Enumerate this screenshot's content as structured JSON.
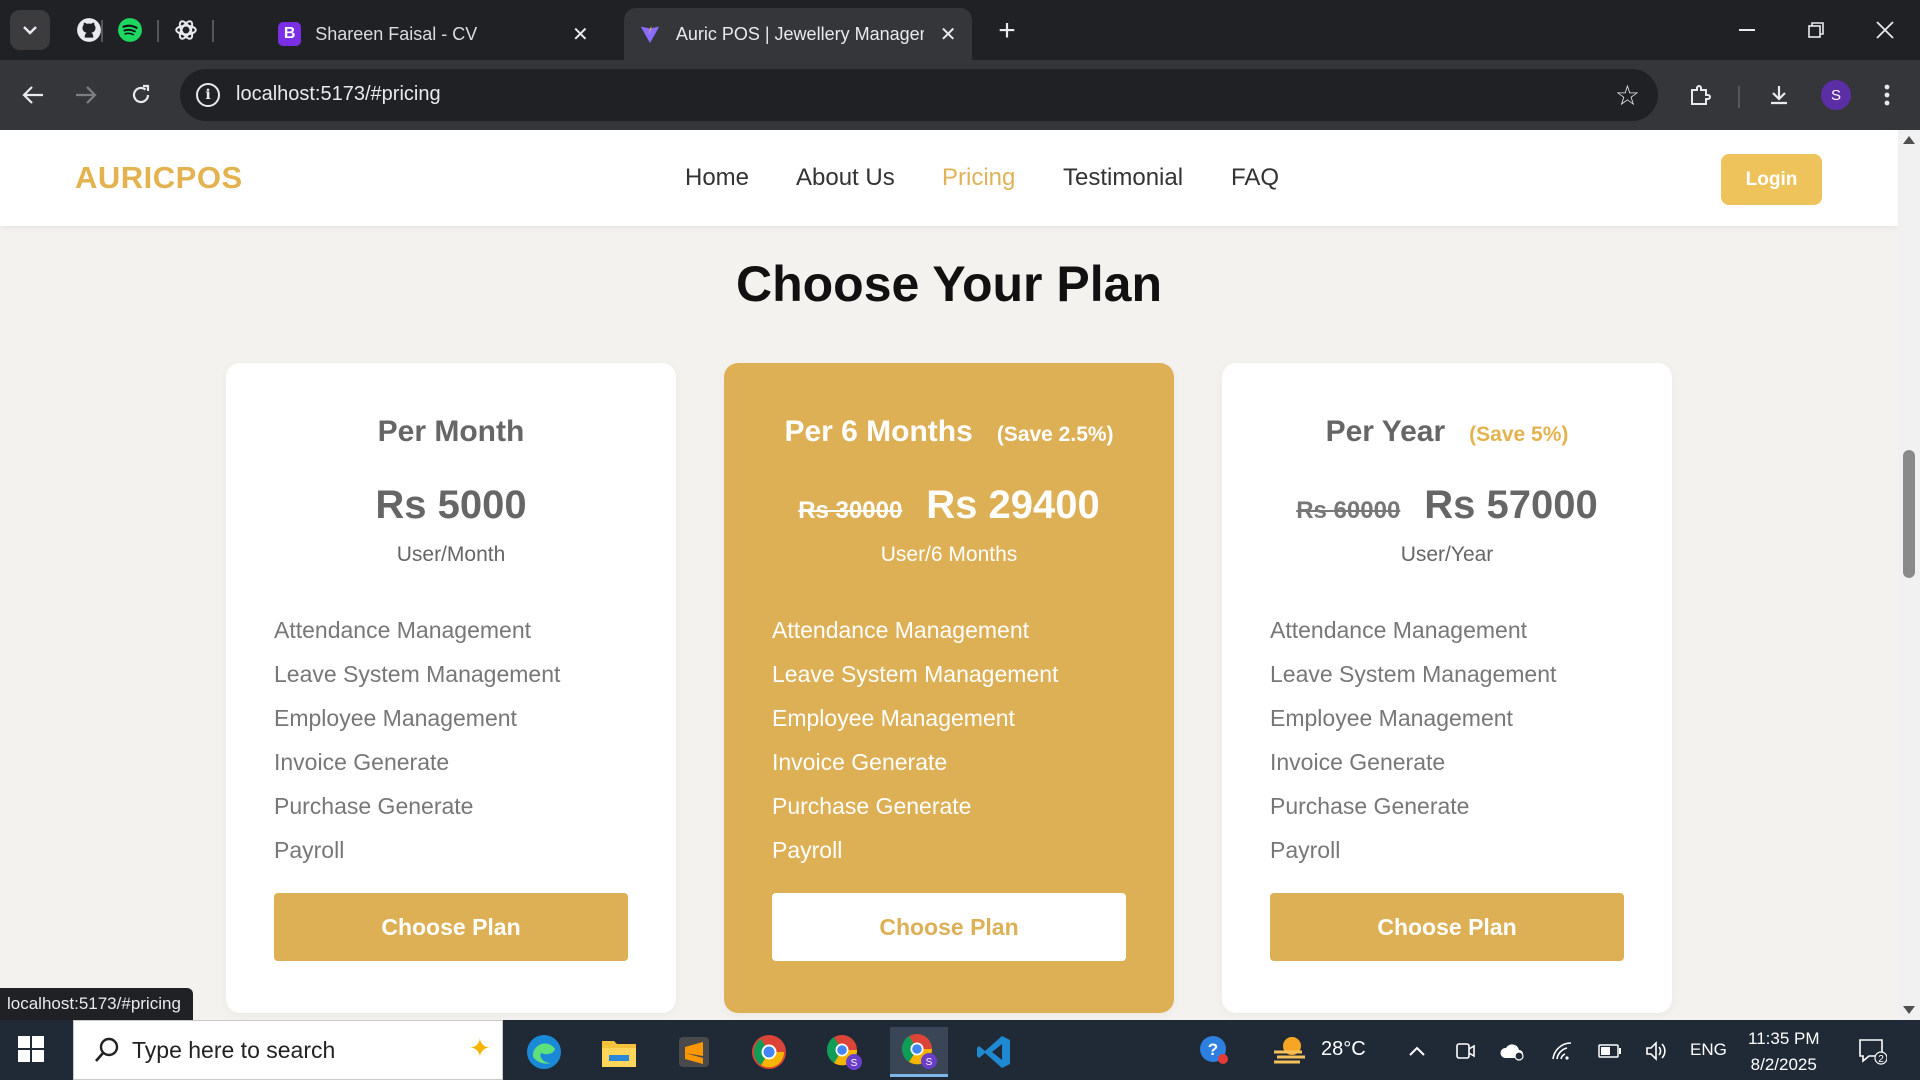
{
  "browser": {
    "tabs": [
      {
        "title": "Shareen Faisal - CV",
        "favicon": "bootstrap-icon",
        "active": false
      },
      {
        "title": "Auric POS | Jewellery Manageme",
        "favicon": "vite-icon",
        "active": true
      }
    ],
    "pinned_tabs": [
      "github-icon",
      "spotify-icon",
      "chatgpt-icon"
    ],
    "url": "localhost:5173/#pricing",
    "profile_initial": "S"
  },
  "site": {
    "logo": "AURICPOS",
    "nav": [
      "Home",
      "About Us",
      "Pricing",
      "Testimonial",
      "FAQ"
    ],
    "active_nav": "Pricing",
    "login_label": "Login",
    "accent_color": "#DEB056"
  },
  "pricing": {
    "title": "Choose Your Plan",
    "plans": [
      {
        "name": "Per Month",
        "save": "",
        "old_price": "",
        "price": "Rs 5000",
        "unit": "User/Month",
        "featured": false,
        "features": [
          "Attendance Management",
          "Leave System Management",
          "Employee Management",
          "Invoice Generate",
          "Purchase Generate",
          "Payroll"
        ],
        "button": "Choose Plan"
      },
      {
        "name": "Per 6 Months",
        "save": "(Save 2.5%)",
        "old_price": "Rs 30000",
        "price": "Rs 29400",
        "unit": "User/6 Months",
        "featured": true,
        "features": [
          "Attendance Management",
          "Leave System Management",
          "Employee Management",
          "Invoice Generate",
          "Purchase Generate",
          "Payroll"
        ],
        "button": "Choose Plan"
      },
      {
        "name": "Per Year",
        "save": "(Save 5%)",
        "old_price": "Rs 60000",
        "price": "Rs 57000",
        "unit": "User/Year",
        "featured": false,
        "features": [
          "Attendance Management",
          "Leave System Management",
          "Employee Management",
          "Invoice Generate",
          "Purchase Generate",
          "Payroll"
        ],
        "button": "Choose Plan"
      }
    ]
  },
  "status_bar": {
    "hover_url": "localhost:5173/#pricing"
  },
  "taskbar": {
    "search_placeholder": "Type here to search",
    "weather": "28°C",
    "language": "ENG",
    "time": "11:35 PM",
    "date": "8/2/2025",
    "notifications": "2",
    "apps": [
      "edge-icon",
      "file-explorer-icon",
      "sublime-text-icon",
      "chrome-icon",
      "chrome-profile-icon",
      "chrome-profile-icon",
      "vscode-icon"
    ]
  }
}
